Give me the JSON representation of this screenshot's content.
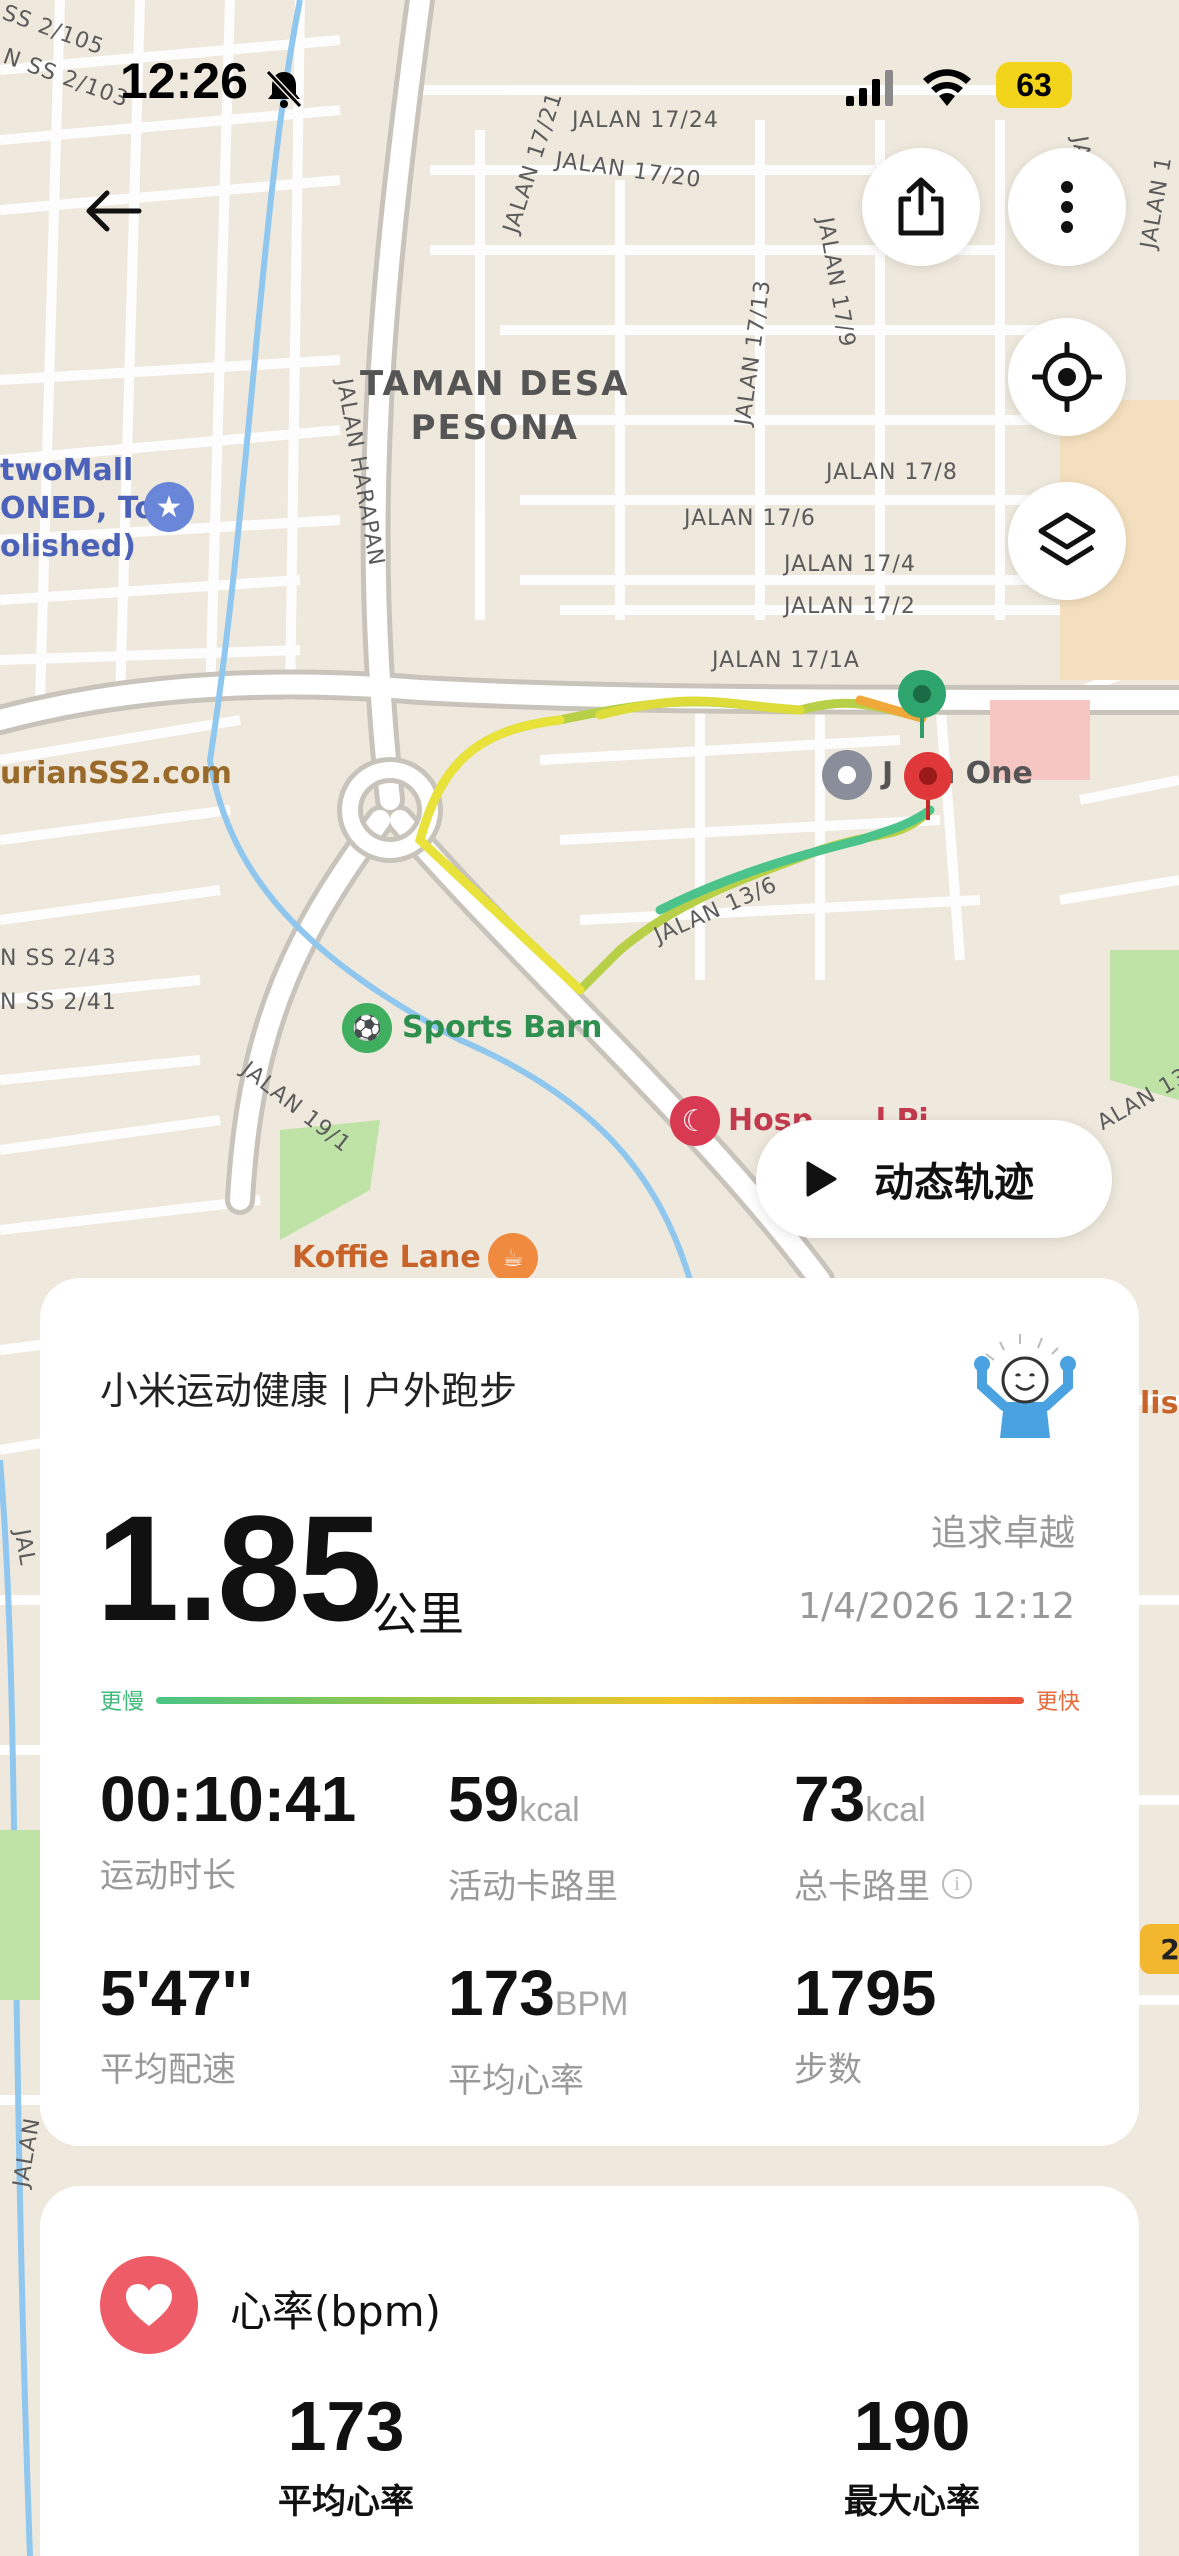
{
  "status_bar": {
    "time": "12:26",
    "battery": "63",
    "icons": [
      "bell-off-icon",
      "cellular-signal-icon",
      "wifi-icon",
      "battery-icon"
    ]
  },
  "map": {
    "areas": {
      "taman_desa_pesona": "TAMAN DESA\nPESONA"
    },
    "streets": {
      "jalan_17_21": "JALAN 17/21",
      "jalan_17_24": "JALAN 17/24",
      "jalan_17_20": "JALAN 17/20",
      "jalan_17_13": "JALAN 17/13",
      "jalan_17_9": "JALAN 17/9",
      "jalan_17_8": "JALAN 17/8",
      "jalan_17_6": "JALAN 17/6",
      "jalan_17_4": "JALAN 17/4",
      "jalan_17_2": "JALAN 17/2",
      "jalan_17_1a": "JALAN 17/1A",
      "jalan_harapan": "JALAN HARAPAN",
      "jalan_13_6": "JALAN 13/6",
      "jalan_19_1": "JALAN 19/1",
      "ss_2_105": "SS 2/105",
      "ss_2_103": "N SS 2/103",
      "ss_2_43": "N SS 2/43",
      "ss_2_41": "N SS 2/41",
      "jalan_13_right": "ALAN 13/",
      "jal_left": "JAL",
      "jalan_bottom_left": "JALAN",
      "jalan_17_right_top": "JALAN 1",
      "jalan_right_top2": "JALAN 1"
    },
    "pois": {
      "mall": "twoMall\nONED, To\nolished)",
      "durian": "urianSS2.com",
      "jaya_one": "J    a One",
      "sports_barn": "Sports Barn",
      "hospital": "Hosp      l Pi",
      "koffie_lane": "Koffie Lane",
      "right_partial": "lis",
      "right_badge": "2"
    }
  },
  "controls": {
    "back": "arrow-left-icon",
    "share": "share-icon",
    "more": "more-vertical-icon",
    "locate": "locate-target-icon",
    "layers": "layers-icon",
    "replay_label": "动态轨迹"
  },
  "summary": {
    "source": "小米运动健康 | 户外跑步",
    "distance": "1.85",
    "distance_unit": "公里",
    "motto": "追求卓越",
    "datetime": "1/4/2026 12:12",
    "pace_slow": "更慢",
    "pace_fast": "更快",
    "stats": [
      {
        "value": "00:10:41",
        "unit": "",
        "label": "运动时长"
      },
      {
        "value": "59",
        "unit": "kcal",
        "label": "活动卡路里"
      },
      {
        "value": "73",
        "unit": "kcal",
        "label": "总卡路里"
      },
      {
        "value": "5'47''",
        "unit": "",
        "label": "平均配速"
      },
      {
        "value": "173",
        "unit": "BPM",
        "label": "平均心率"
      },
      {
        "value": "1795",
        "unit": "",
        "label": "步数"
      }
    ]
  },
  "heart_rate": {
    "title": "心率(bpm)",
    "avg_value": "173",
    "avg_label": "平均心率",
    "max_value": "190",
    "max_label": "最大心率"
  }
}
